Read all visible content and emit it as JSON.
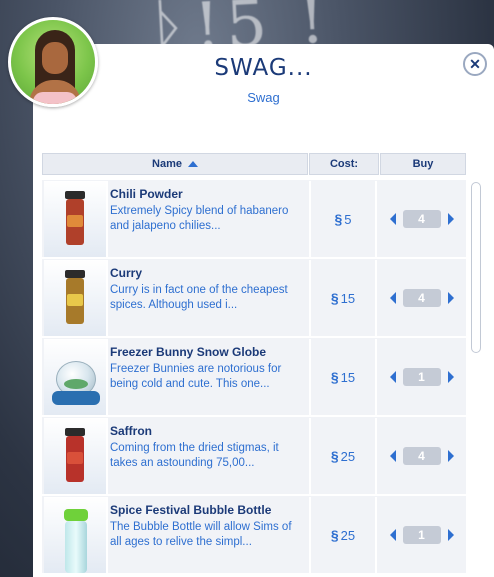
{
  "dialog": {
    "title": "SWAG...",
    "subtitle": "Swag",
    "close_symbol": "✕"
  },
  "columns": {
    "name": "Name",
    "cost": "Cost:",
    "buy": "Buy"
  },
  "currency_symbol": "§",
  "items": [
    {
      "name": "Chili Powder",
      "desc": "Extremely Spicy blend of habanero and jalapeno chilies...",
      "cost": "5",
      "qty": "4",
      "icon": "spice-jar-red-icon"
    },
    {
      "name": "Curry",
      "desc": "Curry is in fact one of the cheapest spices. Although used i...",
      "cost": "15",
      "qty": "4",
      "icon": "spice-jar-yellow-icon"
    },
    {
      "name": "Freezer Bunny Snow Globe",
      "desc": "Freezer Bunnies are notorious for being cold and cute. This one...",
      "cost": "15",
      "qty": "1",
      "icon": "snow-globe-icon"
    },
    {
      "name": "Saffron",
      "desc": "Coming from the dried stigmas, it takes an astounding 75,00...",
      "cost": "25",
      "qty": "4",
      "icon": "spice-jar-red-icon"
    },
    {
      "name": "Spice Festival Bubble Bottle",
      "desc": "The Bubble Bottle will allow Sims of all ages to relive the simpl...",
      "cost": "25",
      "qty": "1",
      "icon": "bubble-bottle-icon"
    }
  ],
  "colors": {
    "title": "#1b3a78",
    "accent": "#2e6fd0",
    "row_bg": "#f1f3f7",
    "qty_bg": "#c5cbd6"
  }
}
